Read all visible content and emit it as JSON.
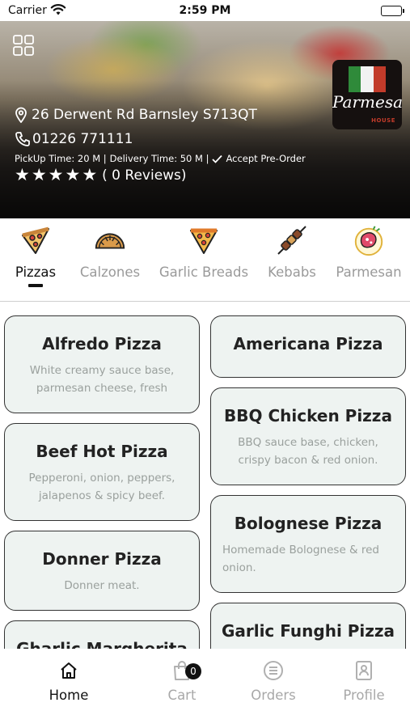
{
  "status_bar": {
    "carrier": "Carrier",
    "time": "2:59 PM"
  },
  "restaurant": {
    "logo_text": "Parmesan",
    "logo_subtext": "HOUSE",
    "address": "26 Derwent Rd Barnsley S713QT",
    "phone": "01226 771111",
    "pickup_time": "PickUp Time: 20 M |",
    "delivery_time": "Delivery Time: 50 M |",
    "pre_order": "Accept Pre-Order",
    "rating": 0,
    "reviews_label": "( 0 Reviews)"
  },
  "categories": [
    {
      "label": "Pizzas",
      "icon": "pizza-slice-icon",
      "active": true
    },
    {
      "label": "Calzones",
      "icon": "calzone-icon",
      "active": false
    },
    {
      "label": "Garlic Breads",
      "icon": "garlic-bread-pizza-icon",
      "active": false
    },
    {
      "label": "Kebabs",
      "icon": "kebab-skewer-icon",
      "active": false
    },
    {
      "label": "Parmesan",
      "icon": "parmesan-meat-icon",
      "active": false
    }
  ],
  "products": [
    {
      "name": "Alfredo Pizza",
      "description": "White creamy sauce base, parmesan cheese, fresh"
    },
    {
      "name": "Americana Pizza",
      "description": ""
    },
    {
      "name": "BBQ Chicken Pizza",
      "description": "BBQ sauce base, chicken, crispy bacon & red onion."
    },
    {
      "name": "Beef Hot Pizza",
      "description": "Pepperoni, onion, peppers, jalapenos & spicy beef."
    },
    {
      "name": "Bolognese Pizza",
      "description": "Homemade Bolognese & red onion."
    },
    {
      "name": "Donner Pizza",
      "description": "Donner meat."
    },
    {
      "name": "Garlic Funghi Pizza",
      "description": ""
    },
    {
      "name": "Gharlic Margherita",
      "description": ""
    }
  ],
  "tabbar": [
    {
      "label": "Home",
      "icon": "home-icon",
      "active": true
    },
    {
      "label": "Cart",
      "icon": "cart-bag-icon",
      "badge": "0",
      "active": false
    },
    {
      "label": "Orders",
      "icon": "orders-list-icon",
      "active": false
    },
    {
      "label": "Profile",
      "icon": "profile-badge-icon",
      "active": false
    }
  ],
  "colors": {
    "card_background": "#eef3f1",
    "card_border": "#333333",
    "inactive_text": "#9a9a9a",
    "active_text": "#111111"
  }
}
